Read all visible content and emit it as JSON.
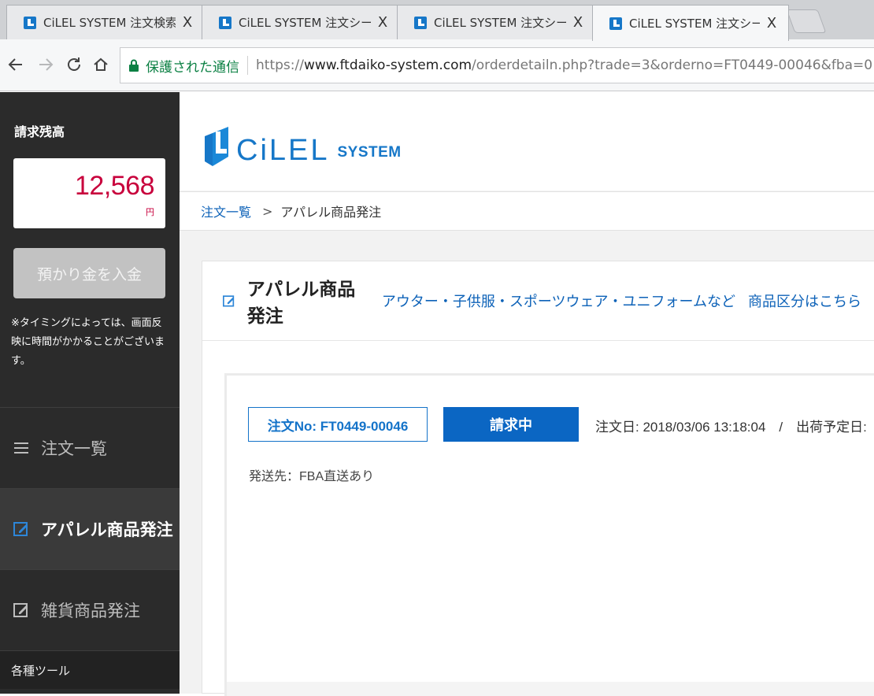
{
  "browser": {
    "tabs": [
      {
        "title": "CiLEL SYSTEM 注文検索・",
        "active": false
      },
      {
        "title": "CiLEL SYSTEM 注文シート(",
        "active": false
      },
      {
        "title": "CiLEL SYSTEM 注文シート(",
        "active": false
      },
      {
        "title": "CiLEL SYSTEM 注文シート(",
        "active": true
      }
    ],
    "close_glyph": "X",
    "secure_label": "保護された通信",
    "url_scheme": "https://",
    "url_host": "www.ftdaiko-system.com",
    "url_path": "/orderdetailn.php?trade=3&orderno=FT0449-00046&fba=0"
  },
  "sidebar": {
    "balance_label": "請求残高",
    "balance_amount": "12,568",
    "balance_unit": "円",
    "deposit_button": "預かり金を入金",
    "note": "※タイミングによっては、画面反映に時間がかかることがございます。",
    "menu": [
      {
        "label": "注文一覧",
        "icon": "list-icon",
        "active": false
      },
      {
        "label": "アパレル商品発注",
        "icon": "edit-icon",
        "active": true
      },
      {
        "label": "雑貨商品発注",
        "icon": "edit-icon",
        "active": false
      }
    ],
    "tools_heading": "各種ツール"
  },
  "header": {
    "logo_text": "CiLEL",
    "logo_sub": "SYSTEM",
    "accent_color": "#1677c8"
  },
  "breadcrumb": {
    "link": "注文一覧",
    "separator": ">",
    "current": "アパレル商品発注"
  },
  "panel": {
    "title": "アパレル商品発注",
    "subtitle_link": "アウター・子供服・スポーツウェア・ユニフォームなど",
    "category_link": "商品区分はこちら"
  },
  "order": {
    "order_no": "注文No: FT0449-00046",
    "status": "請求中",
    "dates": "注文日: 2018/03/06 13:18:04　/　出荷予定日:",
    "ship_to": "発送先：FBA直送あり"
  }
}
